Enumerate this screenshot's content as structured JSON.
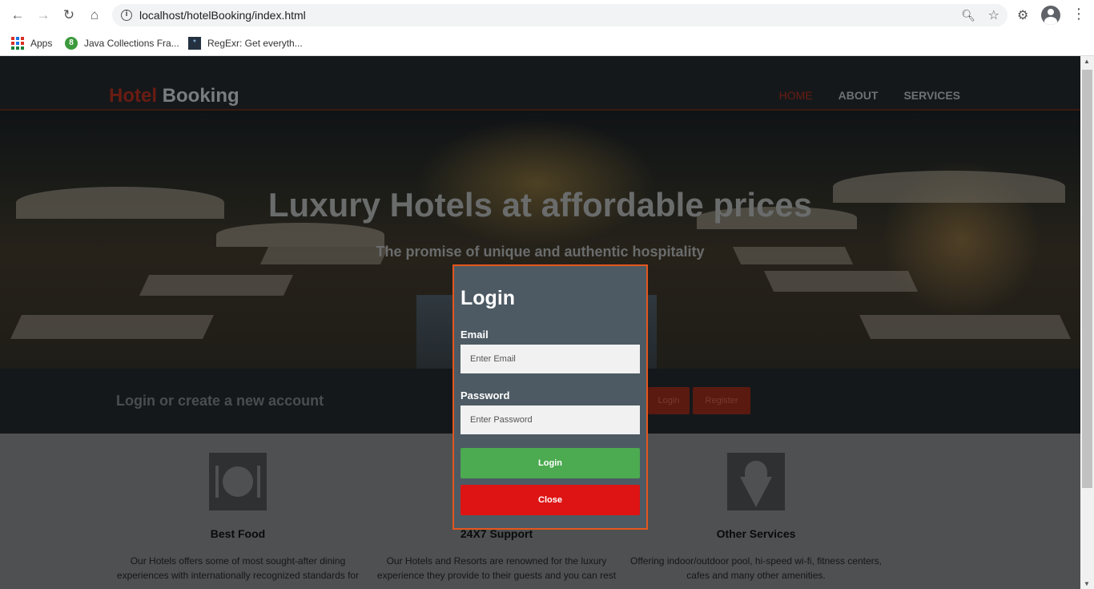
{
  "browser": {
    "url": "localhost/hotelBooking/index.html",
    "bookmarks": [
      {
        "label": "Apps",
        "icon": "apps-grid-icon"
      },
      {
        "label": "Java Collections Fra...",
        "icon": "java-favicon"
      },
      {
        "label": "RegExr: Get everyth...",
        "icon": "regexr-favicon"
      }
    ]
  },
  "site": {
    "logo": {
      "part1": "Hotel",
      "part2": "Booking"
    },
    "nav": [
      {
        "label": "HOME",
        "active": true
      },
      {
        "label": "ABOUT",
        "active": false
      },
      {
        "label": "SERVICES",
        "active": false
      }
    ],
    "hero": {
      "title": "Luxury Hotels at affordable prices",
      "subtitle": "The promise of unique and authentic hospitality"
    },
    "account": {
      "text": "Login or create a new account",
      "login_label": "Login",
      "register_label": "Register"
    },
    "features": [
      {
        "title": "Best Food",
        "icon": "plate-cutlery-icon",
        "desc": "Our Hotels offers some of most sought-after dining experiences with internationally recognized standards for"
      },
      {
        "title": "24X7 Support",
        "icon": "support-icon",
        "desc": "Our Hotels and Resorts are renowned for the luxury experience they provide to their guests and you can rest"
      },
      {
        "title": "Other Services",
        "icon": "ice-cream-icon",
        "desc": "Offering indoor/outdoor pool, hi-speed wi-fi, fitness centers, cafes and many other amenities."
      }
    ]
  },
  "modal": {
    "title": "Login",
    "email_label": "Email",
    "email_placeholder": "Enter Email",
    "email_value": "",
    "password_label": "Password",
    "password_placeholder": "Enter Password",
    "password_value": "",
    "login_button": "Login",
    "close_button": "Close"
  },
  "colors": {
    "modal_bg": "#4d5a63",
    "modal_border": "#e4561d",
    "login_button": "#4caa50",
    "close_button": "#de1414"
  }
}
